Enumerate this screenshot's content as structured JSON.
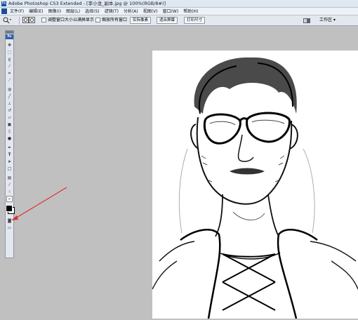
{
  "window": {
    "title": "Adobe Photoshop CS3 Extended - [李小龙_副本.jpg @ 100%(RGB/8#)]",
    "app_icon": "Ps"
  },
  "menu": [
    "文件(F)",
    "编辑(E)",
    "图像(I)",
    "图层(L)",
    "选择(S)",
    "滤镜(T)",
    "分析(A)",
    "视图(V)",
    "窗口(W)",
    "帮助(H)"
  ],
  "options_bar": {
    "zoom_tool_icon": "magnifier-icon",
    "resize_windows_label": "调整窗口大小以满屏显示",
    "zoom_all_windows_label": "缩放所有窗口",
    "actual_pixels_label": "实际像素",
    "fit_screen_label": "适合屏幕",
    "print_size_label": "打印尺寸",
    "workspace_label": "工作区 ▾"
  },
  "toolbox": {
    "logo": "Ps",
    "tools": [
      "move-icon",
      "marquee-icon",
      "lasso-icon",
      "magic-wand-icon",
      "crop-icon",
      "slice-icon",
      "healing-brush-icon",
      "brush-icon",
      "clone-stamp-icon",
      "history-brush-icon",
      "eraser-icon",
      "gradient-icon",
      "blur-icon",
      "dodge-icon",
      "pen-icon",
      "type-icon",
      "path-selection-icon",
      "shape-icon",
      "notes-icon",
      "eyedropper-icon",
      "hand-icon",
      "zoom-icon"
    ],
    "foreground_color": "#000000",
    "background_color": "#ffffff"
  },
  "annotation": {
    "arrow_color": "#e03030"
  }
}
